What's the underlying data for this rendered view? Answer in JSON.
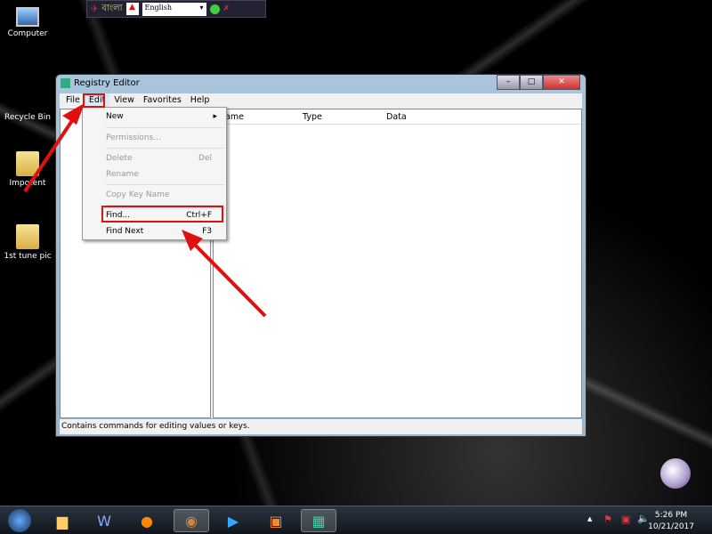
{
  "desktop": {
    "icons": [
      {
        "label": "Computer"
      },
      {
        "label": "Recycle Bin"
      },
      {
        "label": "Impotent"
      },
      {
        "label": "1st tune pic"
      }
    ]
  },
  "langbar": {
    "brand": "বাংলা",
    "language": "English"
  },
  "window": {
    "title": "Registry Editor",
    "controls": {
      "minimize": "–",
      "maximize": "□",
      "close": "✕"
    },
    "menu": [
      "File",
      "Edit",
      "View",
      "Favorites",
      "Help"
    ],
    "columns": [
      "Name",
      "Type",
      "Data"
    ],
    "status": "Contains commands for editing values or keys."
  },
  "edit_menu": {
    "items": [
      {
        "label": "New",
        "shortcut": "",
        "disabled": false
      },
      {
        "label": "Permissions...",
        "shortcut": "",
        "disabled": true
      },
      {
        "label": "Delete",
        "shortcut": "Del",
        "disabled": true
      },
      {
        "label": "Rename",
        "shortcut": "",
        "disabled": true
      },
      {
        "label": "Copy Key Name",
        "shortcut": "",
        "disabled": true
      },
      {
        "label": "Find...",
        "shortcut": "Ctrl+F",
        "disabled": false
      },
      {
        "label": "Find Next",
        "shortcut": "F3",
        "disabled": false
      }
    ]
  },
  "taskbar": {
    "time": "5:26 PM",
    "date": "10/21/2017"
  },
  "colors": {
    "annotation": "#e01010"
  }
}
